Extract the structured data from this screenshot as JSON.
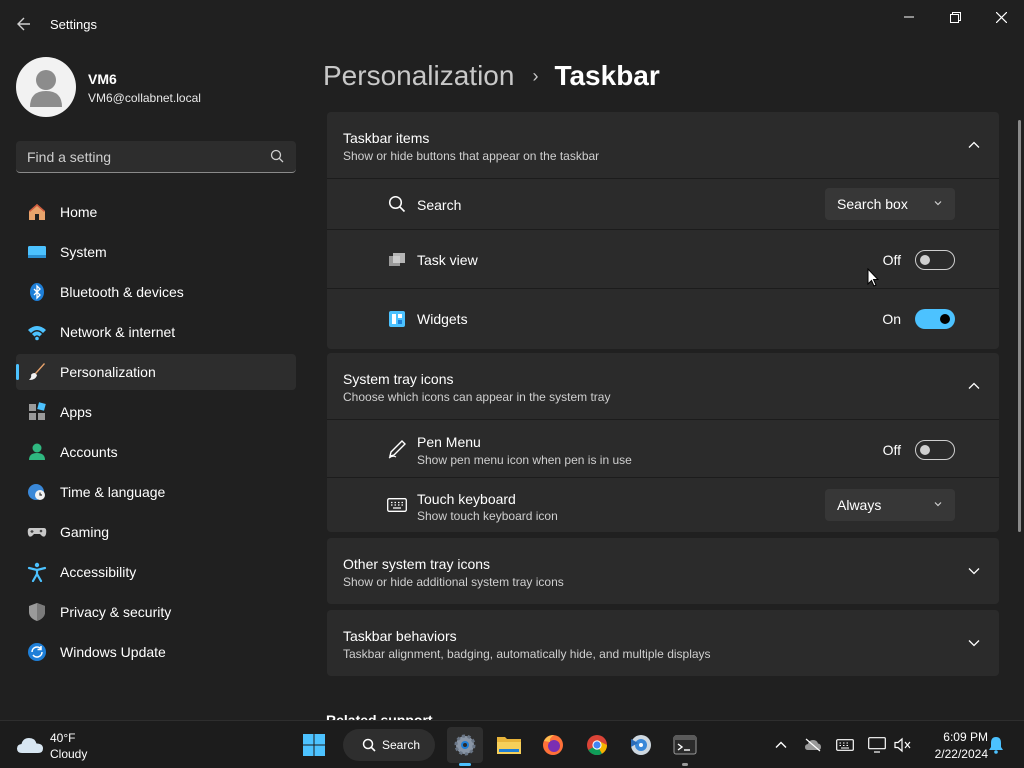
{
  "window": {
    "title": "Settings"
  },
  "profile": {
    "name": "VM6",
    "email": "VM6@collabnet.local"
  },
  "search": {
    "placeholder": "Find a setting"
  },
  "sidebar": {
    "items": [
      {
        "label": "Home",
        "icon": "home-icon"
      },
      {
        "label": "System",
        "icon": "system-icon"
      },
      {
        "label": "Bluetooth & devices",
        "icon": "bluetooth-icon"
      },
      {
        "label": "Network & internet",
        "icon": "wifi-icon"
      },
      {
        "label": "Personalization",
        "icon": "brush-icon",
        "active": true
      },
      {
        "label": "Apps",
        "icon": "apps-icon"
      },
      {
        "label": "Accounts",
        "icon": "accounts-icon"
      },
      {
        "label": "Time & language",
        "icon": "globe-clock-icon"
      },
      {
        "label": "Gaming",
        "icon": "gamepad-icon"
      },
      {
        "label": "Accessibility",
        "icon": "accessibility-icon"
      },
      {
        "label": "Privacy & security",
        "icon": "shield-icon"
      },
      {
        "label": "Windows Update",
        "icon": "update-icon"
      }
    ]
  },
  "breadcrumb": {
    "parent": "Personalization",
    "separator": "›",
    "current": "Taskbar"
  },
  "sections": {
    "taskbar_items": {
      "title": "Taskbar items",
      "subtitle": "Show or hide buttons that appear on the taskbar",
      "expanded": true,
      "rows": {
        "search": {
          "label": "Search",
          "value": "Search box",
          "icon": "search-icon"
        },
        "task_view": {
          "label": "Task view",
          "state": "Off",
          "icon": "task-view-icon"
        },
        "widgets": {
          "label": "Widgets",
          "state": "On",
          "icon": "widgets-icon"
        }
      }
    },
    "system_tray": {
      "title": "System tray icons",
      "subtitle": "Choose which icons can appear in the system tray",
      "expanded": true,
      "rows": {
        "pen_menu": {
          "label": "Pen Menu",
          "sub": "Show pen menu icon when pen is in use",
          "state": "Off",
          "icon": "pen-icon"
        },
        "touch_keyboard": {
          "label": "Touch keyboard",
          "sub": "Show touch keyboard icon",
          "value": "Always",
          "icon": "keyboard-icon"
        }
      }
    },
    "other_tray": {
      "title": "Other system tray icons",
      "subtitle": "Show or hide additional system tray icons",
      "expanded": false
    },
    "behaviors": {
      "title": "Taskbar behaviors",
      "subtitle": "Taskbar alignment, badging, automatically hide, and multiple displays",
      "expanded": false
    }
  },
  "related": {
    "label": "Related support"
  },
  "taskbar": {
    "weather": {
      "temp": "40°F",
      "condition": "Cloudy"
    },
    "search_label": "Search",
    "apps": [
      "start-icon",
      "settings-icon",
      "file-explorer-icon",
      "firefox-icon",
      "chrome-icon",
      "media-icon",
      "terminal-icon"
    ],
    "tray": [
      "chevron-up-icon",
      "onedrive-icon",
      "keyboard-icon",
      "display-icon",
      "speaker-icon",
      "notification-bell-icon"
    ],
    "clock": {
      "time": "6:09 PM",
      "date": "2/22/2024"
    }
  },
  "colors": {
    "accent": "#4cc2ff",
    "background": "#202020",
    "card": "#2b2b2b"
  }
}
